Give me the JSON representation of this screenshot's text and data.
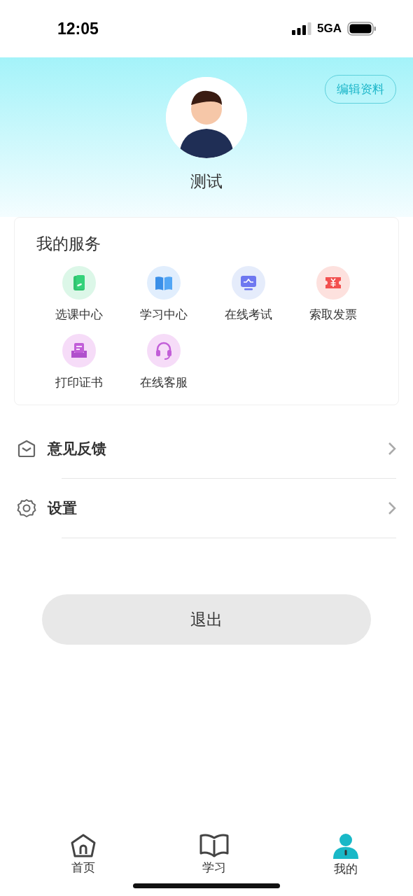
{
  "status_bar": {
    "time": "12:05",
    "network": "5GA"
  },
  "profile": {
    "edit_button": "编辑资料",
    "name": "测试"
  },
  "services": {
    "title": "我的服务",
    "items": [
      {
        "label": "选课中心"
      },
      {
        "label": "学习中心"
      },
      {
        "label": "在线考试"
      },
      {
        "label": "索取发票"
      },
      {
        "label": "打印证书"
      },
      {
        "label": "在线客服"
      }
    ]
  },
  "menu": [
    {
      "label": "意见反馈"
    },
    {
      "label": "设置"
    }
  ],
  "logout_button": "退出",
  "tab_bar": [
    {
      "label": "首页",
      "selected": false
    },
    {
      "label": "学习",
      "selected": false
    },
    {
      "label": "我的",
      "selected": true
    }
  ]
}
